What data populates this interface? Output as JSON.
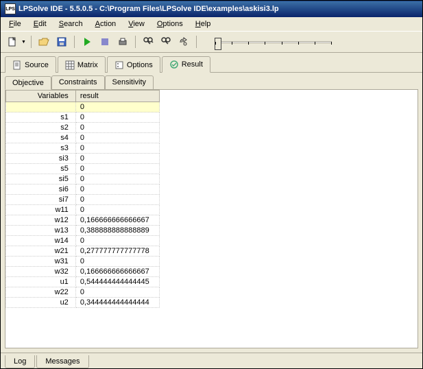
{
  "title": "LPSolve IDE - 5.5.0.5 - C:\\Program Files\\LPSolve IDE\\examples\\askisi3.lp",
  "menu": {
    "file": "File",
    "edit": "Edit",
    "search": "Search",
    "action": "Action",
    "view": "View",
    "options": "Options",
    "help": "Help"
  },
  "tabs": {
    "source": "Source",
    "matrix": "Matrix",
    "options": "Options",
    "result": "Result"
  },
  "subtabs": {
    "objective": "Objective",
    "constraints": "Constraints",
    "sensitivity": "Sensitivity"
  },
  "grid": {
    "headers": {
      "variables": "Variables",
      "result": "result"
    },
    "rows": [
      {
        "variable": "",
        "result": "0",
        "highlight": true
      },
      {
        "variable": "s1",
        "result": "0"
      },
      {
        "variable": "s2",
        "result": "0"
      },
      {
        "variable": "s4",
        "result": "0"
      },
      {
        "variable": "s3",
        "result": "0"
      },
      {
        "variable": "si3",
        "result": "0"
      },
      {
        "variable": "s5",
        "result": "0"
      },
      {
        "variable": "si5",
        "result": "0"
      },
      {
        "variable": "si6",
        "result": "0"
      },
      {
        "variable": "si7",
        "result": "0"
      },
      {
        "variable": "w11",
        "result": "0"
      },
      {
        "variable": "w12",
        "result": "0,166666666666667"
      },
      {
        "variable": "w13",
        "result": "0,388888888888889"
      },
      {
        "variable": "w14",
        "result": "0"
      },
      {
        "variable": "w21",
        "result": "0,277777777777778"
      },
      {
        "variable": "w31",
        "result": "0"
      },
      {
        "variable": "w32",
        "result": "0,166666666666667"
      },
      {
        "variable": "u1",
        "result": "0,544444444444445"
      },
      {
        "variable": "w22",
        "result": "0"
      },
      {
        "variable": "u2",
        "result": "0,344444444444444"
      }
    ]
  },
  "bottomtabs": {
    "log": "Log",
    "messages": "Messages"
  }
}
